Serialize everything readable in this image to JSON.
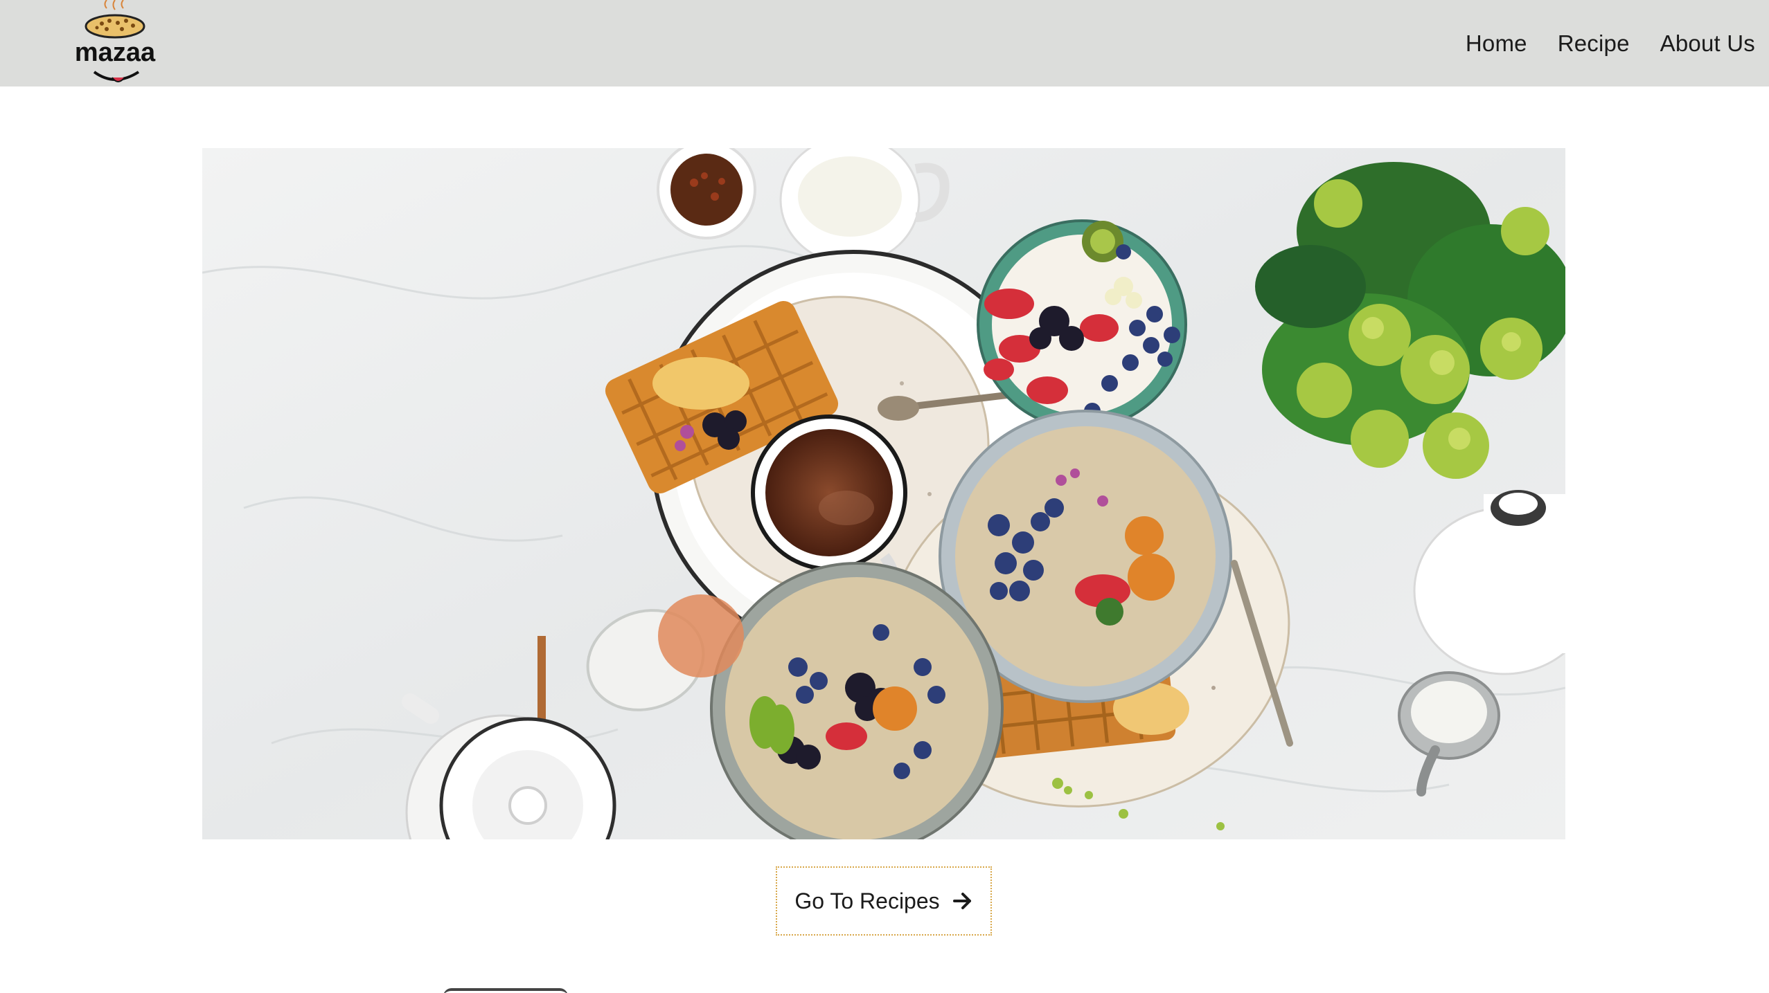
{
  "header": {
    "logo_text": "mazaa",
    "nav": [
      {
        "label": "Home"
      },
      {
        "label": "Recipe"
      },
      {
        "label": "About Us"
      }
    ]
  },
  "hero": {
    "image_subject": "breakfast spread"
  },
  "cta": {
    "label": "Go To Recipes",
    "icon": "arrow-right-icon"
  },
  "colors": {
    "navbar_bg": "#dcdddb",
    "cta_border": "#d8a84a",
    "text": "#1b1b1b"
  }
}
